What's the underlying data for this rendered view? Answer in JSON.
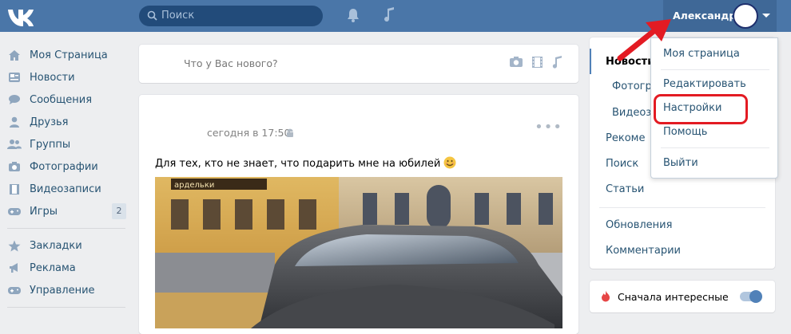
{
  "header": {
    "search_placeholder": "Поиск",
    "user_name": "Александр"
  },
  "left_menu": {
    "items": [
      {
        "label": "Моя Страница"
      },
      {
        "label": "Новости"
      },
      {
        "label": "Сообщения"
      },
      {
        "label": "Друзья"
      },
      {
        "label": "Группы"
      },
      {
        "label": "Фотографии"
      },
      {
        "label": "Видеозаписи"
      },
      {
        "label": "Игры",
        "badge": "2"
      }
    ],
    "items2": [
      {
        "label": "Закладки"
      },
      {
        "label": "Реклама"
      },
      {
        "label": "Управление"
      }
    ]
  },
  "composer": {
    "placeholder": "Что у Вас нового?"
  },
  "post": {
    "time": "сегодня в 17:50",
    "text": "Для тех, кто не знает, что подарить мне на юбилей"
  },
  "right_menu": {
    "items": [
      "Новости",
      "Фотогра",
      "Видеоза",
      "Рекоме",
      "Поиск",
      "Статьи",
      "Обновления",
      "Комментарии"
    ]
  },
  "filter": {
    "label": "Сначала интересные"
  },
  "dropdown": {
    "items": [
      "Моя страница",
      "Редактировать",
      "Настройки",
      "Помощь",
      "Выйти"
    ]
  },
  "colors": {
    "header": "#4a76a8",
    "highlight": "#e31b23",
    "link": "#285473"
  }
}
